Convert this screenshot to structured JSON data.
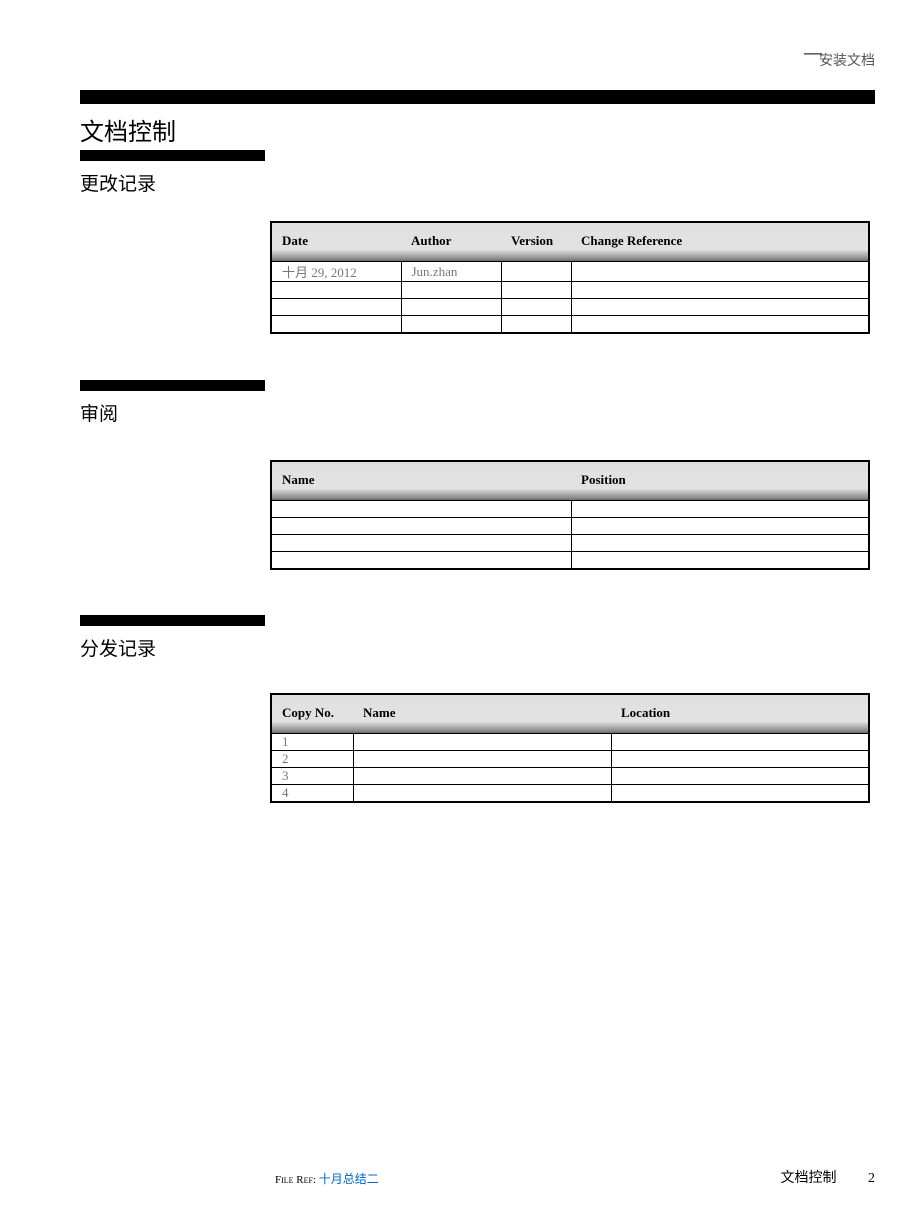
{
  "header": {
    "dash": "—",
    "text": "安装文档"
  },
  "main_title": "文档控制",
  "sections": {
    "changes": {
      "title": "更改记录",
      "headers": {
        "date": "Date",
        "author": "Author",
        "version": "Version",
        "change_ref": "Change Reference"
      },
      "rows": [
        {
          "date": "十月 29, 2012",
          "author": "Jun.zhan",
          "version": "",
          "change_ref": ""
        },
        {
          "date": "",
          "author": "",
          "version": "",
          "change_ref": ""
        },
        {
          "date": "",
          "author": "",
          "version": "",
          "change_ref": ""
        },
        {
          "date": "",
          "author": "",
          "version": "",
          "change_ref": ""
        }
      ]
    },
    "review": {
      "title": "审阅",
      "headers": {
        "name": "Name",
        "position": "Position"
      },
      "rows": [
        {
          "name": "",
          "position": ""
        },
        {
          "name": "",
          "position": ""
        },
        {
          "name": "",
          "position": ""
        },
        {
          "name": "",
          "position": ""
        }
      ]
    },
    "distribution": {
      "title": "分发记录",
      "headers": {
        "copy_no": "Copy No.",
        "name": "Name",
        "location": "Location"
      },
      "rows": [
        {
          "copy_no": "1",
          "name": "",
          "location": ""
        },
        {
          "copy_no": "2",
          "name": "",
          "location": ""
        },
        {
          "copy_no": "3",
          "name": "",
          "location": ""
        },
        {
          "copy_no": "4",
          "name": "",
          "location": ""
        }
      ]
    }
  },
  "footer": {
    "file_ref_label": "File Ref:",
    "file_ref_value": "十月总结二",
    "section_name": "文档控制",
    "page_number": "2"
  }
}
